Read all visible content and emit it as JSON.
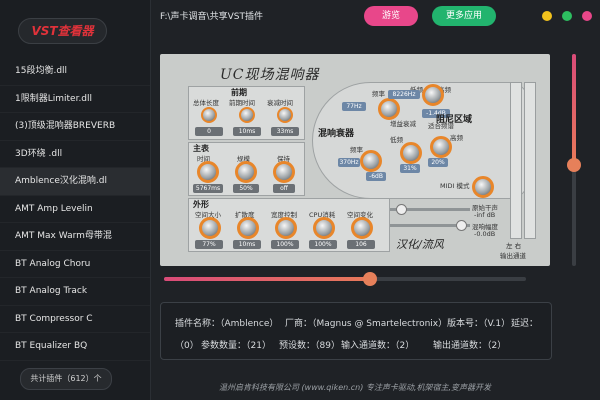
{
  "app": {
    "title": "VST查看器",
    "path": "F:\\声卡调音\\共享VST插件"
  },
  "header": {
    "browse_label": "游览",
    "more_apps_label": "更多应用"
  },
  "window_buttons": {
    "minimize_color": "#f2c21d",
    "maximize_color": "#2dbe60",
    "close_color": "#e8478a"
  },
  "sidebar": {
    "items": [
      {
        "label": "15段均衡.dll"
      },
      {
        "label": "1限制器Limiter.dll"
      },
      {
        "label": "(3)顶级混响器BREVERB"
      },
      {
        "label": "3D环绕 .dll"
      },
      {
        "label": "Amblence汉化混响.dl"
      },
      {
        "label": "AMT Amp Levelin"
      },
      {
        "label": "AMT Max Warm母带混"
      },
      {
        "label": "BT Analog Choru"
      },
      {
        "label": "BT Analog Track"
      },
      {
        "label": "BT Compressor C"
      },
      {
        "label": "BT Equalizer BQ"
      }
    ],
    "total_label": "共计插件（612）个"
  },
  "plugin": {
    "title": "UC现场混响器",
    "early": {
      "section": "前期",
      "labels": [
        "总体长度",
        "前期时间",
        "衰减时间"
      ],
      "values": [
        "0",
        "10ms",
        "33ms"
      ]
    },
    "reverb": {
      "section": "主表",
      "labels": [
        "时间",
        "规模",
        "保持"
      ],
      "values": [
        "5767ms",
        "50%",
        "off"
      ]
    },
    "shape": {
      "section": "外形",
      "labels": [
        "空间大小",
        "扩散度",
        "宽度控制",
        "CPU消耗",
        "空间变化"
      ],
      "values": [
        "77%",
        "10ms",
        "100%",
        "100%",
        "106"
      ]
    },
    "damping": {
      "title": "阻尼区域",
      "freq_label": "频率",
      "lowfreq_label": "低频",
      "highfreq_label": "高频",
      "freq_value": "8226Hz",
      "lowfreq_value": "77Hz",
      "high_value": "-1.4dB",
      "cut_label": "增益衰减",
      "curve_label": "适合频谱"
    },
    "mixer": {
      "title": "混响衰器",
      "freq_value": "370Hz",
      "low_value": "-6dB",
      "mid_value": "31%",
      "high_value": "20%",
      "freq_label": "频率",
      "low_label": "低频",
      "high_label": "高频"
    },
    "midi_label": "MIDI 模式",
    "dry_label": "原始干声",
    "dry_value": "-inf dB",
    "wet_label": "混响幅度",
    "wet_value": "-0.0dB",
    "credit": "汉化/流风",
    "output_label": "输出通道",
    "lr_label": "左 右"
  },
  "sliders": {
    "horizontal_value": 0.57,
    "vertical_value": 0.52
  },
  "info": {
    "name_label": "插件名称：（Amblence）",
    "vendor_label": "厂商：（Magnus @ Smartelectronix）",
    "version_label": "版本号：（V.1）",
    "delay_label": "延迟：",
    "delay_value": "（0）",
    "params_label": "参数数量：（21）",
    "presets_label": "预设数：（89）",
    "inputs_label": "输入通道数：（2）",
    "outputs_label": "输出通道数：（2）"
  },
  "footer": {
    "text": "温州启肯科技有限公司 (www.qiken.cn) 专注声卡驱动,机架宿主,变声器开发"
  }
}
